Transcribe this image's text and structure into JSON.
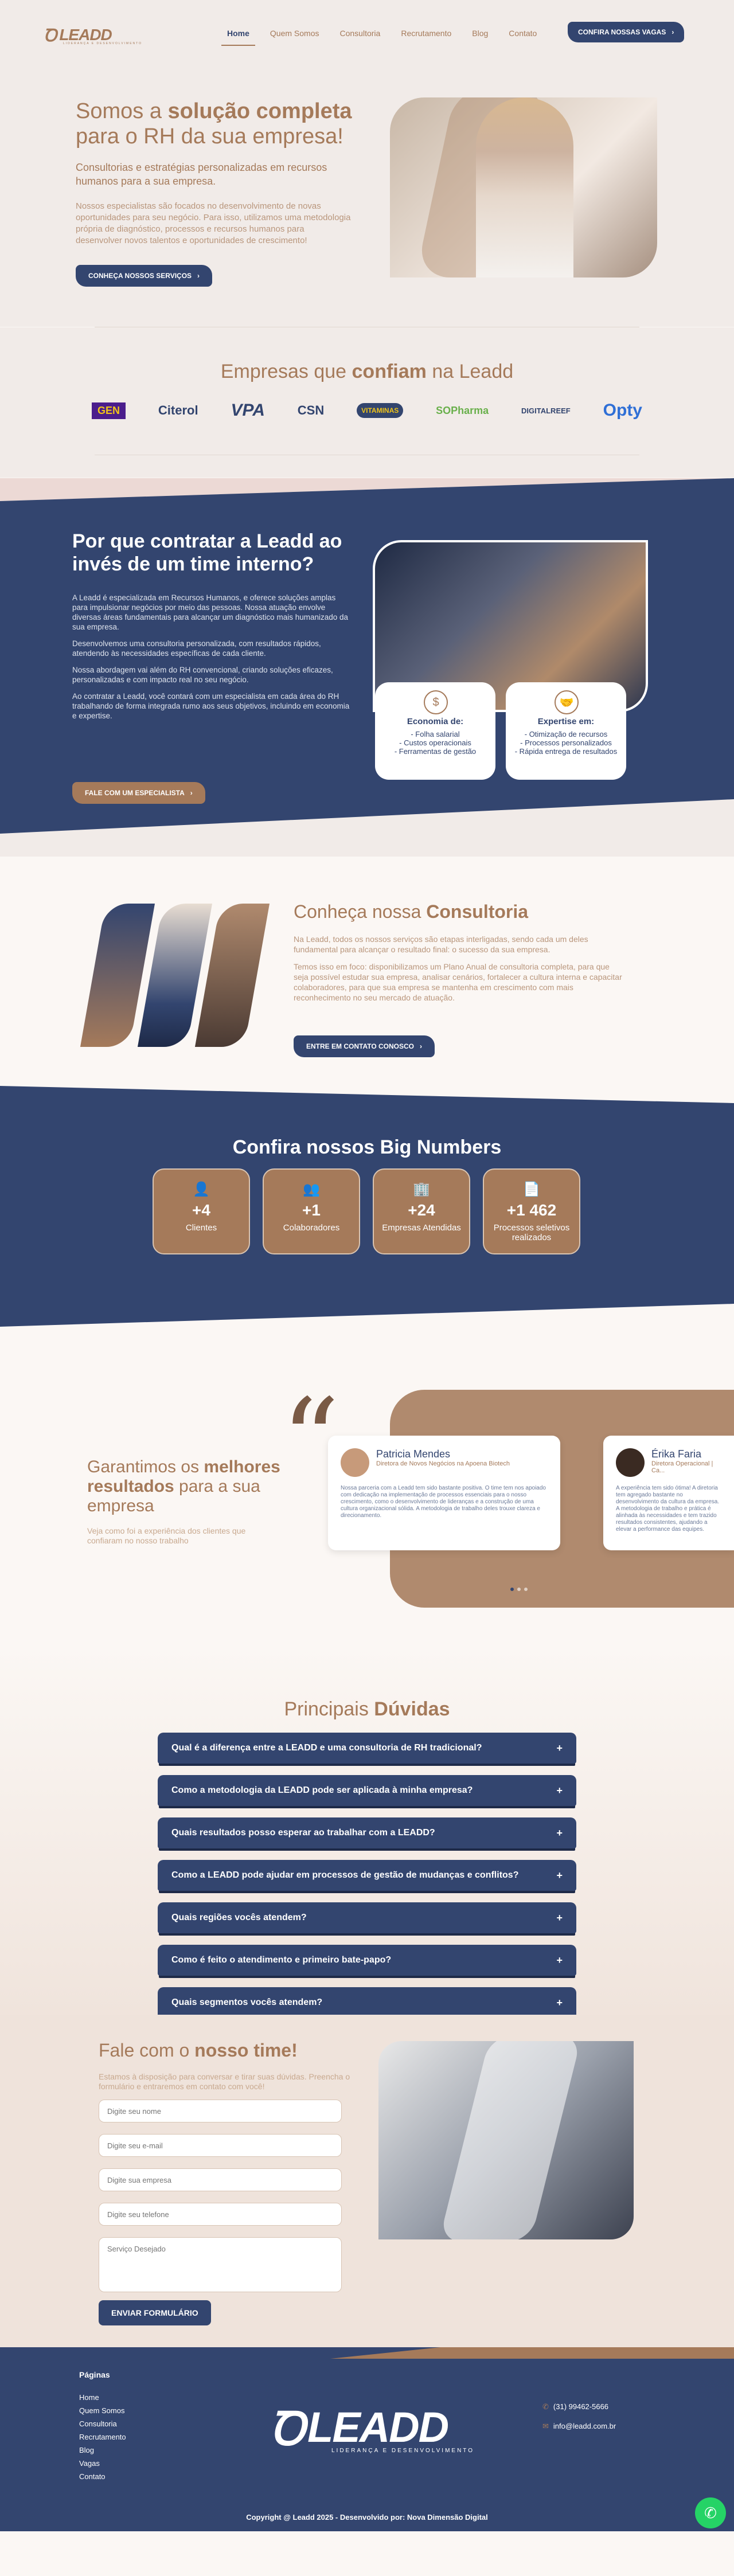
{
  "header": {
    "logo_mark": "Ꝺ",
    "logo_text": "LEADD",
    "logo_sub": "LIDERANÇA E DESENVOLVIMENTO",
    "nav": [
      "Home",
      "Quem Somos",
      "Consultoria",
      "Recrutamento",
      "Blog",
      "Contato"
    ],
    "cta": "CONFIRA NOSSAS VAGAS"
  },
  "hero": {
    "title_a": "Somos a ",
    "title_b": "solução completa",
    "title_c": " para o RH da sua empresa!",
    "lead": "Consultorias e estratégias personalizadas em recursos humanos para a sua empresa.",
    "body": "Nossos especialistas são focados no desenvolvimento de novas oportunidades para seu negócio. Para isso, utilizamos uma metodologia própria de diagnóstico, processos e recursos humanos para desenvolver novos talentos e oportunidades de crescimento!",
    "cta": "CONHEÇA NOSSOS SERVIÇOS"
  },
  "clients": {
    "title_a": "Empresas que ",
    "title_b": "confiam",
    "title_c": " na Leadd",
    "logos": [
      "GEN",
      "Citerol",
      "VPA",
      "CSN",
      "VITAMINAS",
      "SOPharma",
      "DIGITALREEF",
      "Opty"
    ]
  },
  "why": {
    "title": "Por que contratar a Leadd ao invés de um time interno?",
    "p1": "A Leadd é especializada em Recursos Humanos, e oferece soluções amplas para impulsionar negócios por meio das pessoas. Nossa atuação envolve diversas áreas fundamentais para alcançar um diagnóstico mais humanizado da sua empresa.",
    "p2": "Desenvolvemos uma consultoria personalizada, com resultados rápidos, atendendo às necessidades específicas de cada cliente.",
    "p3": "Nossa abordagem vai além do RH convencional, criando soluções eficazes, personalizadas e com impacto real no seu negócio.",
    "p4": "Ao contratar a Leadd, você contará com um especialista em cada área do RH trabalhando de forma integrada rumo aos seus objetivos, incluindo em economia e expertise.",
    "cta": "FALE COM UM ESPECIALISTA",
    "card1_title": "Economia de:",
    "card1_items": [
      "- Folha salarial",
      "- Custos operacionais",
      "- Ferramentas de gestão"
    ],
    "card2_title": "Expertise em:",
    "card2_items": [
      "- Otimização de recursos",
      "- Processos personalizados",
      "- Rápida entrega de resultados"
    ]
  },
  "consult": {
    "title_a": "Conheça nossa ",
    "title_b": "Consultoria",
    "p1": "Na Leadd, todos os nossos serviços são etapas interligadas, sendo cada um deles fundamental para alcançar o resultado final: o sucesso da sua empresa.",
    "p2": "Temos isso em foco: disponibilizamos um Plano Anual de consultoria completa, para que seja possível estudar sua empresa, analisar cenários, fortalecer a cultura interna e capacitar colaboradores, para que sua empresa se mantenha em crescimento com mais reconhecimento no seu mercado de atuação.",
    "cta": "ENTRE EM CONTATO CONOSCO"
  },
  "bignumbers": {
    "title": "Confira nossos Big Numbers",
    "items": [
      {
        "icon": "user-icon",
        "n": "+4",
        "l": "Clientes"
      },
      {
        "icon": "team-icon",
        "n": "+1",
        "l": "Colaboradores"
      },
      {
        "icon": "building-icon",
        "n": "+24",
        "l": "Empresas Atendidas"
      },
      {
        "icon": "document-icon",
        "n": "+1 462",
        "l": "Processos seletivos realizados"
      }
    ]
  },
  "testimonials": {
    "title_a": "Garantimos os ",
    "title_b": "melhores resultados",
    "title_c": " para a sua empresa",
    "sub": "Veja como foi a experiência dos clientes que confiaram no nosso trabalho",
    "items": [
      {
        "name": "Patricia Mendes",
        "role": "Diretora de Novos Negócios na Apoena Biotech",
        "text": "Nossa parceria com a Leadd tem sido bastante positiva. O time tem nos apoiado com dedicação na implementação de processos essenciais para o nosso crescimento, como o desenvolvimento de lideranças e a construção de uma cultura organizacional sólida. A metodologia de trabalho deles trouxe clareza e direcionamento."
      },
      {
        "name": "Érika Faria",
        "role": "Diretora Operacional | Ca...",
        "text": "A experiência tem sido ótima! A diretoria tem agregado bastante no desenvolvimento da cultura da empresa. A metodologia de trabalho e prática é alinhada às necessidades e tem trazido resultados consistentes, ajudando a elevar a performance das equipes."
      }
    ]
  },
  "faq": {
    "title_a": "Principais ",
    "title_b": "Dúvidas",
    "items": [
      "Qual é a diferença entre a LEADD e uma consultoria de RH tradicional?",
      "Como a metodologia da LEADD pode ser aplicada à minha empresa?",
      "Quais resultados posso esperar ao trabalhar com a LEADD?",
      "Como a LEADD pode ajudar em processos de gestão de mudanças e conflitos?",
      "Quais regiões vocês atendem?",
      "Como é feito o atendimento e primeiro bate-papo?",
      "Quais segmentos vocês atendem?"
    ]
  },
  "contact": {
    "title_a": "Fale com o ",
    "title_b": "nosso time!",
    "sub": "Estamos à disposição para conversar e tirar suas dúvidas. Preencha o formulário e entraremos em contato com você!",
    "ph_name": "Digite seu nome",
    "ph_email": "Digite seu e-mail",
    "ph_company": "Digite sua empresa",
    "ph_phone": "Digite seu telefone",
    "ph_service": "Serviço Desejado",
    "submit": "ENVIAR FORMULÁRIO"
  },
  "footer": {
    "pages_title": "Páginas",
    "links": [
      "Home",
      "Quem Somos",
      "Consultoria",
      "Recrutamento",
      "Blog",
      "Vagas",
      "Contato"
    ],
    "logo_mark": "Ꝺ",
    "logo_text": "LEADD",
    "logo_sub": "LIDERANÇA E DESENVOLVIMENTO",
    "phone": "(31) 99462-5666",
    "email": "info@leadd.com.br",
    "copyright": "Copyright @ Leadd 2025 - Desenvolvido por: Nova Dimensão Digital"
  }
}
